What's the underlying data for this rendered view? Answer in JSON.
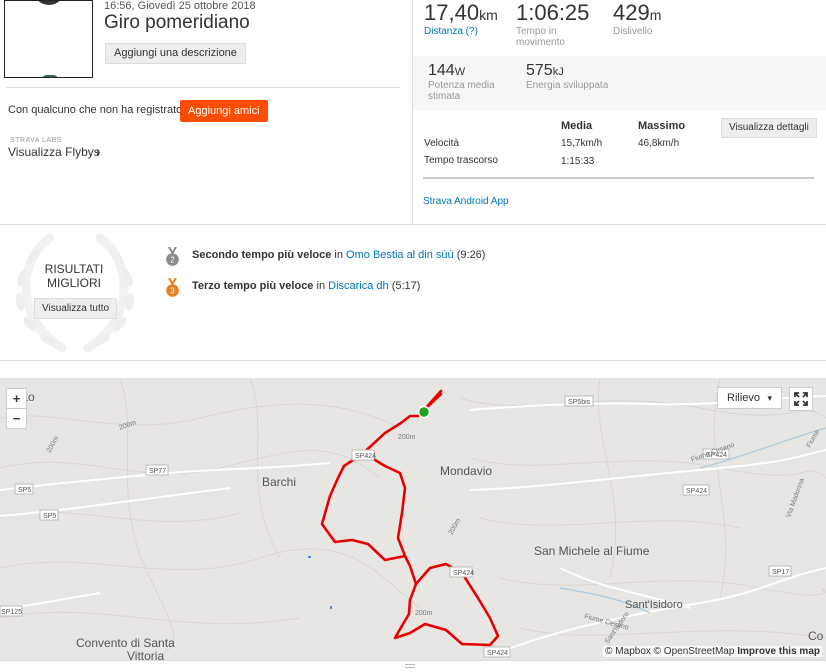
{
  "activity": {
    "date": "16:56, Giovedì 25 ottobre 2018",
    "title": "Giro pomeridiano",
    "add_description": "Aggiungi una descrizione"
  },
  "social": {
    "unregistered_text": "Con qualcuno che non ha registrato?",
    "add_friends": "Aggiungi amici",
    "labs_label": "STRAVA LABS",
    "flyby_label": "Visualizza Flybys",
    "flyby_chevron": "›"
  },
  "stats": {
    "distance": {
      "value": "17,40",
      "unit": "km",
      "label": "Distanza (?)"
    },
    "moving_time": {
      "value": "1:06:25",
      "label_line1": "Tempo in",
      "label_line2": "movimento"
    },
    "elevation": {
      "value": "429",
      "unit": "m",
      "label": "Dislivello"
    },
    "power": {
      "value": "144",
      "unit": "W",
      "label_line1": "Potenza media",
      "label_line2": "stimata"
    },
    "energy": {
      "value": "575",
      "unit": "kJ",
      "label": "Energia sviluppata"
    }
  },
  "table": {
    "col_avg": "Media",
    "col_max": "Massimo",
    "details_button": "Visualizza dettagli",
    "rows": [
      {
        "label": "Velocità",
        "avg": "15,7km/h",
        "max": "46,8km/h"
      },
      {
        "label": "Tempo trascorso",
        "avg": "1:15:33",
        "max": ""
      }
    ],
    "app_link": "Strava Android App"
  },
  "achievements": {
    "title_line1": "RISULTATI",
    "title_line2": "MIGLIORI",
    "view_all": "Visualizza tutto",
    "items": [
      {
        "medal": "2",
        "medal_color": "#8a8a8a",
        "rank": "Secondo tempo più veloce",
        "in": " in ",
        "segment": "Omo Bestia al din sùù",
        "time": " (9:26)"
      },
      {
        "medal": "3",
        "medal_color": "#e5821f",
        "rank": "Terzo tempo più veloce",
        "in": " in ",
        "segment": "Discarica dh",
        "time": " (5:17)"
      }
    ]
  },
  "map": {
    "zoom_in": "+",
    "zoom_out": "−",
    "layer_select": "Rilievo",
    "layer_caret": "▾",
    "attribution_a": "© Mapbox © OpenStreetMap ",
    "attribution_b": "Improve this map",
    "route_color": "#e60000",
    "start_color": "#1da21d",
    "places": [
      "Mondavio",
      "Barchi",
      "San Michele al Fiume",
      "Sant'Isidoro",
      "Convento di Santa",
      "Vittoria",
      "polito",
      "Co"
    ],
    "roads": [
      "SP5bis",
      "SP424",
      "SP77",
      "SP5",
      "SP5",
      "SP424",
      "SP424",
      "SP17",
      "SP125",
      "SP424",
      "SP424"
    ],
    "other_labels": [
      "200m",
      "200m",
      "200m",
      "200m",
      "200m",
      "Fiume Cesano",
      "Fiume Cesano",
      "Via Madonna",
      "Sant'Isidoro",
      "Fiume"
    ]
  }
}
